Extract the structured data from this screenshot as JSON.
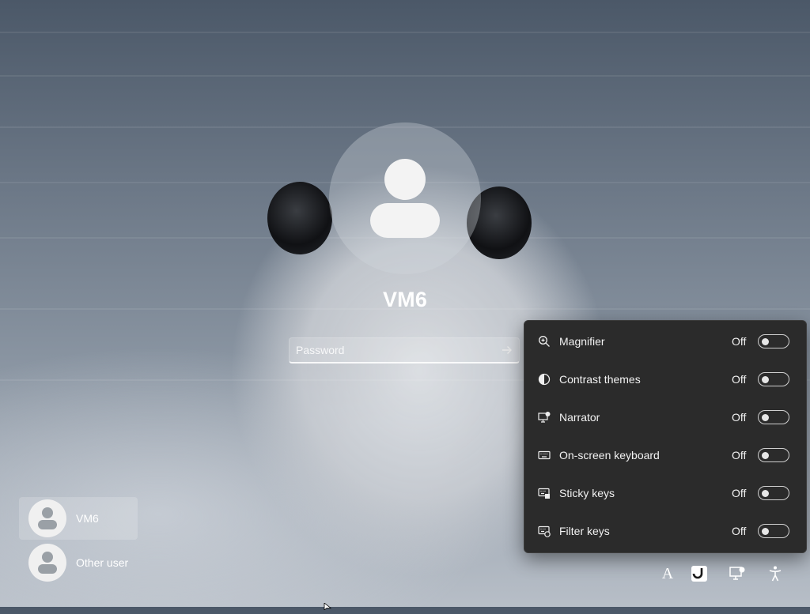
{
  "screen": {
    "background": "harbor-seal-pup-on-snow"
  },
  "login": {
    "username": "VM6",
    "password_placeholder": "Password",
    "submit_icon": "arrow-right-icon"
  },
  "users": [
    {
      "name": "VM6",
      "selected": true
    },
    {
      "name": "Other user",
      "selected": false
    }
  ],
  "accessibility": {
    "items": [
      {
        "label": "Magnifier",
        "state": "Off",
        "icon": "magnifier-icon"
      },
      {
        "label": "Contrast themes",
        "state": "Off",
        "icon": "contrast-icon"
      },
      {
        "label": "Narrator",
        "state": "Off",
        "icon": "narrator-icon"
      },
      {
        "label": "On-screen keyboard",
        "state": "Off",
        "icon": "keyboard-icon"
      },
      {
        "label": "Sticky keys",
        "state": "Off",
        "icon": "sticky-keys-icon"
      },
      {
        "label": "Filter keys",
        "state": "Off",
        "icon": "filter-keys-icon"
      }
    ]
  },
  "tray": {
    "language_label": "A",
    "icons": [
      "language-icon",
      "network-icon",
      "display-icon",
      "accessibility-icon"
    ]
  },
  "colors": {
    "flyout_bg": "#2b2b2b",
    "text": "#ffffff"
  }
}
